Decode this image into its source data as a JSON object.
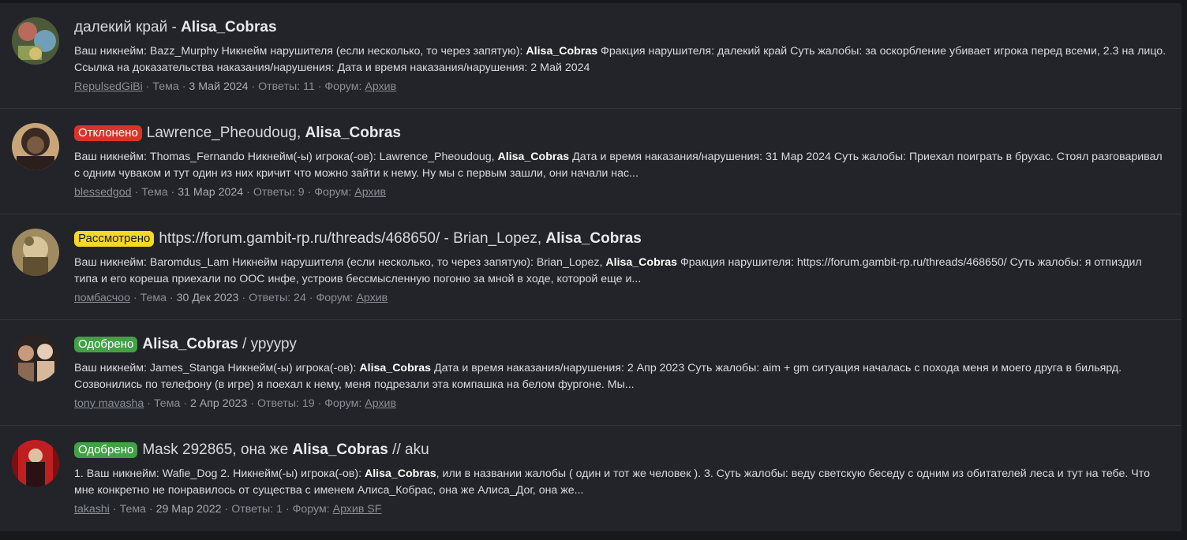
{
  "results": [
    {
      "prefix": "",
      "title_plain": "далекий край - ",
      "title_bold": "Alisa_Cobras",
      "title_tail": "",
      "avatar_colors": [
        "#4c5a3a",
        "#b86a5d",
        "#6fa0b8"
      ],
      "snippet_parts": [
        {
          "t": "Ваш никнейм: Bazz_Murphy Никнейм нарушителя (если несколько, то через запятую): ",
          "b": false
        },
        {
          "t": "Alisa_Cobras",
          "b": true
        },
        {
          "t": " Фракция нарушителя: далекий край Суть жалобы: за оскорбление убивает игрока перед всеми, 2.3 на лицо. Ссылка на доказательства наказания/нарушения: Дата и время наказания/нарушения: 2 Май 2024",
          "b": false
        }
      ],
      "author": "RepulsedGiBi",
      "type": "Тема",
      "date": "3 Май 2024",
      "replies": "Ответы: 11",
      "forum_label": "Форум:",
      "forum": "Архив"
    },
    {
      "prefix": "Отклонено",
      "prefix_style": "red",
      "title_plain": "Lawrence_Pheoudoug, ",
      "title_bold": "Alisa_Cobras",
      "title_tail": "",
      "avatar_colors": [
        "#3a2a22",
        "#7a5a40",
        "#c9a57a"
      ],
      "snippet_parts": [
        {
          "t": "Ваш никнейм: Thomas_Fernando Никнейм(-ы) игрока(-ов): Lawrence_Pheoudoug, ",
          "b": false
        },
        {
          "t": "Alisa_Cobras",
          "b": true
        },
        {
          "t": " Дата и время наказания/нарушения: 31 Мар 2024 Суть жалобы: Приехал поиграть в брухас. Стоял разговаривал с одним чуваком и тут один из них кричит что можно зайти к нему. Ну мы с первым зашли, они начали нас...",
          "b": false
        }
      ],
      "author": "blessedgod",
      "type": "Тема",
      "date": "31 Мар 2024",
      "replies": "Ответы: 9",
      "forum_label": "Форум:",
      "forum": "Архив"
    },
    {
      "prefix": "Рассмотрено",
      "prefix_style": "yellow",
      "title_plain": "https://forum.gambit-rp.ru/threads/468650/ - Brian_Lopez, ",
      "title_bold": "Alisa_Cobras",
      "title_tail": "",
      "avatar_colors": [
        "#a08a60",
        "#d8c49a",
        "#5e5030"
      ],
      "snippet_parts": [
        {
          "t": "Ваш никнейм: Baromdus_Lam Никнейм нарушителя (если несколько, то через запятую): Brian_Lopez, ",
          "b": false
        },
        {
          "t": "Alisa_Cobras",
          "b": true
        },
        {
          "t": " Фракция нарушителя: https://forum.gambit-rp.ru/threads/468650/ Суть жалобы: я отпиздил типа и его кореша приехали по ООС инфе, устроив бессмысленную погоню за мной в ходе, которой еще и...",
          "b": false
        }
      ],
      "author": "помбасчоо",
      "type": "Тема",
      "date": "30 Дек 2023",
      "replies": "Ответы: 24",
      "forum_label": "Форум:",
      "forum": "Архив"
    },
    {
      "prefix": "Одобрено",
      "prefix_style": "green",
      "title_plain": "",
      "title_bold": "Alisa_Cobras",
      "title_tail": " / урууру",
      "avatar_colors": [
        "#2b2320",
        "#c79a7c",
        "#e6cdb8"
      ],
      "snippet_parts": [
        {
          "t": "Ваш никнейм: James_Stanga Никнейм(-ы) игрока(-ов): ",
          "b": false
        },
        {
          "t": "Alisa_Cobras",
          "b": true
        },
        {
          "t": " Дата и время наказания/нарушения: 2 Апр 2023 Суть жалобы: aim + gm ситуация началась с похода меня и моего друга в бильярд. Созвонились по телефону (в игре) я поехал к нему, меня подрезали эта компашка на белом фургоне. Мы...",
          "b": false
        }
      ],
      "author": "tony mavasha",
      "type": "Тема",
      "date": "2 Апр 2023",
      "replies": "Ответы: 19",
      "forum_label": "Форум:",
      "forum": "Архив"
    },
    {
      "prefix": "Одобрено",
      "prefix_style": "green",
      "title_plain": "Mask 292865, она же ",
      "title_bold": "Alisa_Cobras",
      "title_tail": " // aku",
      "avatar_colors": [
        "#c01f22",
        "#2a1214",
        "#e0c0a0"
      ],
      "snippet_parts": [
        {
          "t": "1. Ваш никнейм: Wafie_Dog 2. Никнейм(-ы) игрока(-ов): ",
          "b": false
        },
        {
          "t": "Alisa_Cobras",
          "b": true
        },
        {
          "t": ", или в названии жалобы ( один и тот же человек ). 3. Суть жалобы: веду светскую беседу с одним из обитателей леса и тут на тебе. Что мне конкретно не понравилось от существа с именем Алиса_Кобрас, она же Алиса_Дог, она же...",
          "b": false
        }
      ],
      "author": "takashi",
      "type": "Тема",
      "date": "29 Мар 2022",
      "replies": "Ответы: 1",
      "forum_label": "Форум:",
      "forum": "Архив SF"
    }
  ]
}
